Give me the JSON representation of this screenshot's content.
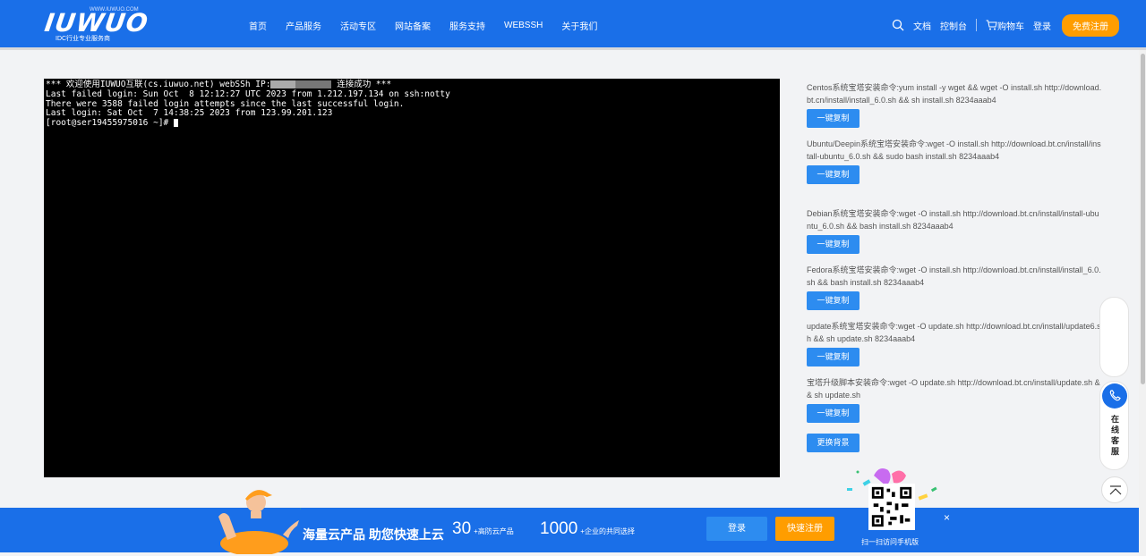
{
  "header": {
    "logo_text": "IUWUO",
    "logo_tagline": "IDC行业专业服务商",
    "logo_url": "WWW.IUWUO.COM",
    "nav": [
      "首页",
      "产品服务",
      "活动专区",
      "网站备案",
      "服务支持",
      "WEBSSH",
      "关于我们"
    ],
    "right": {
      "docs": "文档",
      "console": "控制台",
      "cart": "购物车",
      "login": "登录",
      "register": "免费注册"
    }
  },
  "terminal": {
    "line1_prefix": "*** 欢迎使用IUWUO互联(cs.iuwuo.net) webSSh IP:",
    "line1_suffix": " 连接成功 ***",
    "line2": "Last failed login: Sun Oct  8 12:12:27 UTC 2023 from 1.212.197.134 on ssh:notty",
    "line3": "There were 3588 failed login attempts since the last successful login.",
    "line4": "Last login: Sat Oct  7 14:38:25 2023 from 123.99.201.123",
    "prompt": "[root@ser19455975016 ~]# "
  },
  "commands": [
    {
      "text": "Centos系统宝塔安装命令:yum install -y wget && wget -O install.sh http://download.bt.cn/install/install_6.0.sh && sh install.sh 8234aaab4",
      "button": "一键复制"
    },
    {
      "text": "Ubuntu/Deepin系统宝塔安装命令:wget -O install.sh http://download.bt.cn/install/install-ubuntu_6.0.sh && sudo bash install.sh 8234aaab4",
      "button": "一键复制"
    },
    {
      "text": "Debian系统宝塔安装命令:wget -O install.sh http://download.bt.cn/install/install-ubuntu_6.0.sh && bash install.sh 8234aaab4",
      "button": "一键复制"
    },
    {
      "text": "Fedora系统宝塔安装命令:wget -O install.sh http://download.bt.cn/install/install_6.0.sh && bash install.sh 8234aaab4",
      "button": "一键复制"
    },
    {
      "text": "update系统宝塔安装命令:wget -O update.sh http://download.bt.cn/install/update6.sh && sh update.sh 8234aaab4",
      "button": "一键复制"
    },
    {
      "text": "宝塔升级脚本安装命令:wget -O update.sh http://download.bt.cn/install/update.sh && sh update.sh",
      "button": "一键复制"
    }
  ],
  "change_bg_button": "更换背景",
  "service": {
    "label": "在线客服"
  },
  "banner": {
    "title": "海量云产品 助您快速上云",
    "stat1_num": "30",
    "stat1_label": "+高防云产品",
    "stat2_num": "1000",
    "stat2_label": "+企业的共同选择",
    "login": "登录",
    "register": "快速注册",
    "qr_caption": "扫一扫访问手机版",
    "close": "×"
  },
  "colors": {
    "brand_blue": "#1a6fe8",
    "button_blue": "#2d8cf0",
    "accent_orange": "#ff9d00",
    "terminal_bg": "#000000"
  },
  "icons": [
    "search-icon",
    "cart-icon",
    "phone-icon",
    "back-to-top-icon",
    "close-icon",
    "qr-code"
  ]
}
